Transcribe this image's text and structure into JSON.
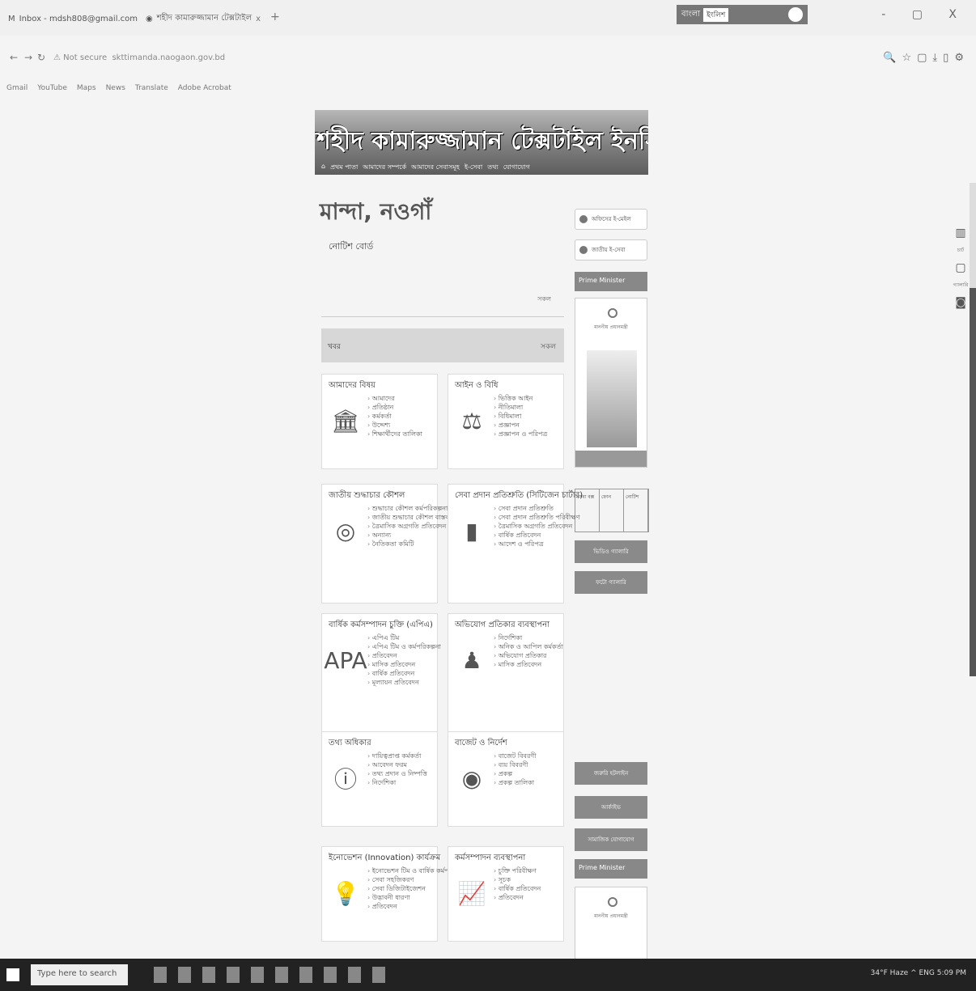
{
  "tabs": [
    {
      "label": "Inbox - mdsh808@gmail.com",
      "close": "x"
    },
    {
      "label": "শহীদ কামারুজ্জামান টেক্সটাইল",
      "close": "x"
    }
  ],
  "newtab": "+",
  "language_bar": {
    "left": "বাংলা",
    "box": "ইংলিশ"
  },
  "window_controls": "- ▢ X",
  "address": {
    "back": "←",
    "forward": "→",
    "reload": "↻",
    "security": "Not secure",
    "url": "skttimanda.naogaon.gov.bd"
  },
  "bookmarks": [
    "Gmail",
    "YouTube",
    "Maps",
    "News",
    "Translate",
    "Adobe Acrobat"
  ],
  "banner": {
    "title": "শহীদ কামারুজ্জামান টেক্সটাইল ইনস্টিটিউট,",
    "menu": [
      "প্রথম পাতা",
      "আমাদের সম্পর্কে",
      "আমাদের সেবাসমূহ",
      "ই-সেবা",
      "তথ্য",
      "যোগাযোগ"
    ]
  },
  "subtitle": "মান্দা, নওগাঁ",
  "notice": {
    "heading": "নোটিশ বোর্ড",
    "arrow": "সকল"
  },
  "news": {
    "label": "খবর",
    "more": "সকল"
  },
  "cards": [
    {
      "title": "আমাদের বিষয়",
      "icon": "🏛",
      "items": [
        "আমাদের",
        "প্রতিষ্ঠান",
        "কর্মকর্তা",
        "উদ্দেশ্য",
        "শিক্ষার্থীদের তালিকা"
      ]
    },
    {
      "title": "আইন ও বিধি",
      "icon": "⚖",
      "items": [
        "ভিত্তিক আইন",
        "নীতিমালা",
        "বিধিমালা",
        "প্রজ্ঞাপন",
        "প্রজ্ঞাপন ও পরিপত্র"
      ]
    },
    {
      "title": "জাতীয় শুদ্ধাচার কৌশল",
      "icon": "◎",
      "items": [
        "শুদ্ধাচার কৌশল কর্মপরিকল্পনা",
        "জাতীয় শুদ্ধাচার কৌশল বাস্তবায়ন",
        "ত্রৈমাসিক অগ্রগতি প্রতিবেদন",
        "অন্যান্য",
        "নৈতিকতা কমিটি"
      ]
    },
    {
      "title": "সেবা প্রদান প্রতিশ্রুতি (সিটিজেন চার্টার)",
      "icon": "▮",
      "items": [
        "সেবা প্রদান প্রতিশ্রুতি",
        "সেবা প্রদান প্রতিশ্রুতি পরিবীক্ষণ",
        "ত্রৈমাসিক অগ্রগতি প্রতিবেদন",
        "বার্ষিক প্রতিবেদন",
        "আদেশ ও পরিপত্র"
      ]
    },
    {
      "title": "বার্ষিক কর্মসম্পাদন চুক্তি (এপিএ)",
      "icon": "APA",
      "items": [
        "এপিএ টিম",
        "এপিএ টিম ও কর্মপরিকল্পনা",
        "প্রতিবেদন",
        "মাসিক প্রতিবেদন",
        "বার্ষিক প্রতিবেদন",
        "মূল্যায়ন প্রতিবেদন"
      ]
    },
    {
      "title": "অভিযোগ প্রতিকার ব্যবস্থাপনা",
      "icon": "♟",
      "items": [
        "নির্দেশিকা",
        "অনিক ও আপিল কর্মকর্তা",
        "অভিযোগ প্রতিকার",
        "মাসিক প্রতিবেদন"
      ]
    },
    {
      "title": "তথ্য অধিকার",
      "icon": "ⓘ",
      "items": [
        "দায়িত্বপ্রাপ্ত কর্মকর্তা",
        "আবেদন ফরম",
        "তথ্য প্রদান ও নিষ্পত্তি",
        "নির্দেশিকা"
      ]
    },
    {
      "title": "বাজেট ও নির্দেশ",
      "icon": "◉",
      "items": [
        "বাজেট বিবরণী",
        "ব্যয় বিবরণী",
        "প্রকল্প",
        "প্রকল্প তালিকা"
      ]
    },
    {
      "title": "ইনোভেশন (Innovation) কার্যক্রম",
      "icon": "💡",
      "items": [
        "ইনোভেশন টিম ও বার্ষিক কর্মপরিকল্পনা",
        "সেবা সহজিকরণ",
        "সেবা ডিজিটাইজেশন",
        "উদ্ভাবনী ধারণা",
        "প্রতিবেদন"
      ]
    },
    {
      "title": "কর্মসম্পাদন ব্যবস্থাপনা",
      "icon": "📈",
      "items": [
        "চুক্তি পরিবীক্ষণ",
        "সূচক",
        "বার্ষিক প্রতিবেদন",
        "প্রতিবেদন"
      ]
    }
  ],
  "sidebar": {
    "btn1": "অফিসের ই-মেইল",
    "btn2": "জাতীয় ই-সেবা",
    "head1": "Prime Minister",
    "head2": "Prime Minister",
    "pm_text": "মাননীয় প্রধানমন্ত্রী",
    "small": [
      "সেবা বক্স",
      "ফোন",
      "নোটিশ"
    ],
    "gray": [
      "ভিডিও গ্যালারি",
      "ফটো গ্যালারি",
      "জরুরি হটলাইন",
      "আর্কাইভ",
      "সামাজিক যোগাযোগ"
    ]
  },
  "float": {
    "label1": "চার্ট",
    "label2": "গ্যালারি"
  },
  "taskbar": {
    "search": "Type here to search",
    "tray": "34°F Haze  ^ ENG  5:09 PM"
  }
}
